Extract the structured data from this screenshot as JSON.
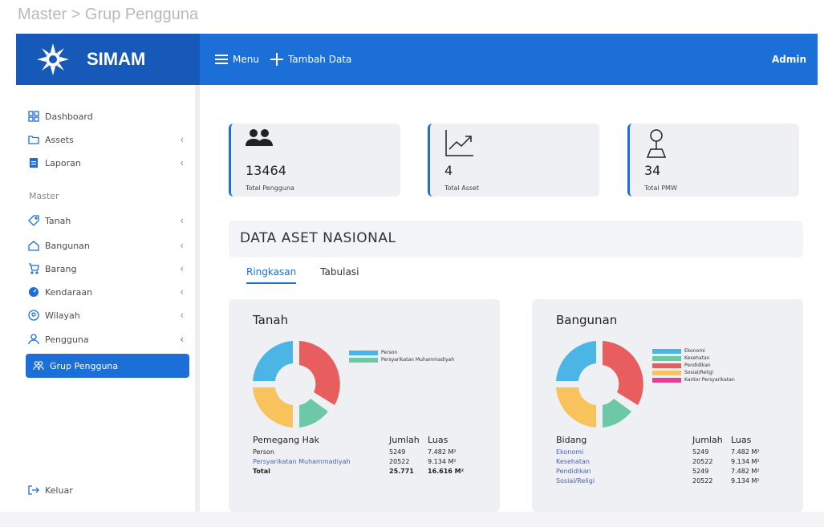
{
  "breadcrumb": "Master > Grup Pengguna",
  "app": {
    "name": "SIMAM"
  },
  "topnav": {
    "menu_label": "Menu",
    "add_label": "Tambah Data",
    "user_label": "Admin"
  },
  "sidebar": {
    "items": [
      {
        "label": "Dashboard",
        "icon": "dashboard-icon"
      },
      {
        "label": "Assets",
        "icon": "folder-icon",
        "chevron": "‹"
      },
      {
        "label": "Laporan",
        "icon": "report-icon",
        "chevron": "‹"
      }
    ],
    "section_label": "Master",
    "master_items": [
      {
        "label": "Tanah",
        "icon": "tag-icon",
        "chevron": "‹"
      },
      {
        "label": "Bangunan",
        "icon": "home-icon",
        "chevron": "‹"
      },
      {
        "label": "Barang",
        "icon": "cart-icon",
        "chevron": "‹"
      },
      {
        "label": "Kendaraan",
        "icon": "speedometer-icon",
        "chevron": "‹"
      },
      {
        "label": "Wilayah",
        "icon": "location-icon",
        "chevron": "‹"
      },
      {
        "label": "Pengguna",
        "icon": "user-icon",
        "chevron": "‹"
      },
      {
        "label": "Grup Pengguna",
        "icon": "users-icon"
      }
    ],
    "logout_label": "Keluar"
  },
  "stats": [
    {
      "value": "13464",
      "label": "Total Pengguna",
      "icon": "users-icon"
    },
    {
      "value": "4",
      "label": "Total Asset",
      "icon": "chart-up-icon"
    },
    {
      "value": "34",
      "label": "Total PMW",
      "icon": "map-pin-icon"
    }
  ],
  "section_title": "DATA ASET NASIONAL",
  "tabs": [
    {
      "label": "Ringkasan",
      "active": true
    },
    {
      "label": "Tabulasi",
      "active": false
    }
  ],
  "tanah": {
    "title": "Tanah",
    "legend": [
      {
        "label": "Person",
        "color": "#4bb6e6"
      },
      {
        "label": "Persyarikatan Muhammadiyah",
        "color": "#6cc8a6"
      }
    ],
    "table": {
      "headers": [
        "Pemegang Hak",
        "Jumlah",
        "Luas"
      ],
      "rows": [
        {
          "name": "Person",
          "jumlah": "5249",
          "luas": "7.482 M²"
        },
        {
          "name": "Persyarikatan Muhammadiyah",
          "jumlah": "20522",
          "luas": "9.134 M²"
        },
        {
          "name": "Total",
          "jumlah": "25.771",
          "luas": "16.616 M²"
        }
      ]
    }
  },
  "bangunan": {
    "title": "Bangunan",
    "legend": [
      {
        "label": "Ekonomi",
        "color": "#4bb6e6"
      },
      {
        "label": "Kesehatan",
        "color": "#6cc8a6"
      },
      {
        "label": "Pendidikan",
        "color": "#e85d5d"
      },
      {
        "label": "Sosial/Religi",
        "color": "#f8c25c"
      },
      {
        "label": "Kantor Persyarikatan",
        "color": "#e83c9a"
      }
    ],
    "table": {
      "headers": [
        "Bidang",
        "Jumlah",
        "Luas"
      ],
      "rows": [
        {
          "name": "Ekonomi",
          "jumlah": "5249",
          "luas": "7.482 M²"
        },
        {
          "name": "Kesehatan",
          "jumlah": "20522",
          "luas": "9.134 M²"
        },
        {
          "name": "Pendidikan",
          "jumlah": "5249",
          "luas": "7.482 M²"
        },
        {
          "name": "Sosial/Religi",
          "jumlah": "20522",
          "luas": "9.134 M²"
        }
      ]
    }
  },
  "colors": {
    "primary": "#1b6fd6",
    "brand_bg": "#1659b8",
    "link": "#4a60c8"
  }
}
